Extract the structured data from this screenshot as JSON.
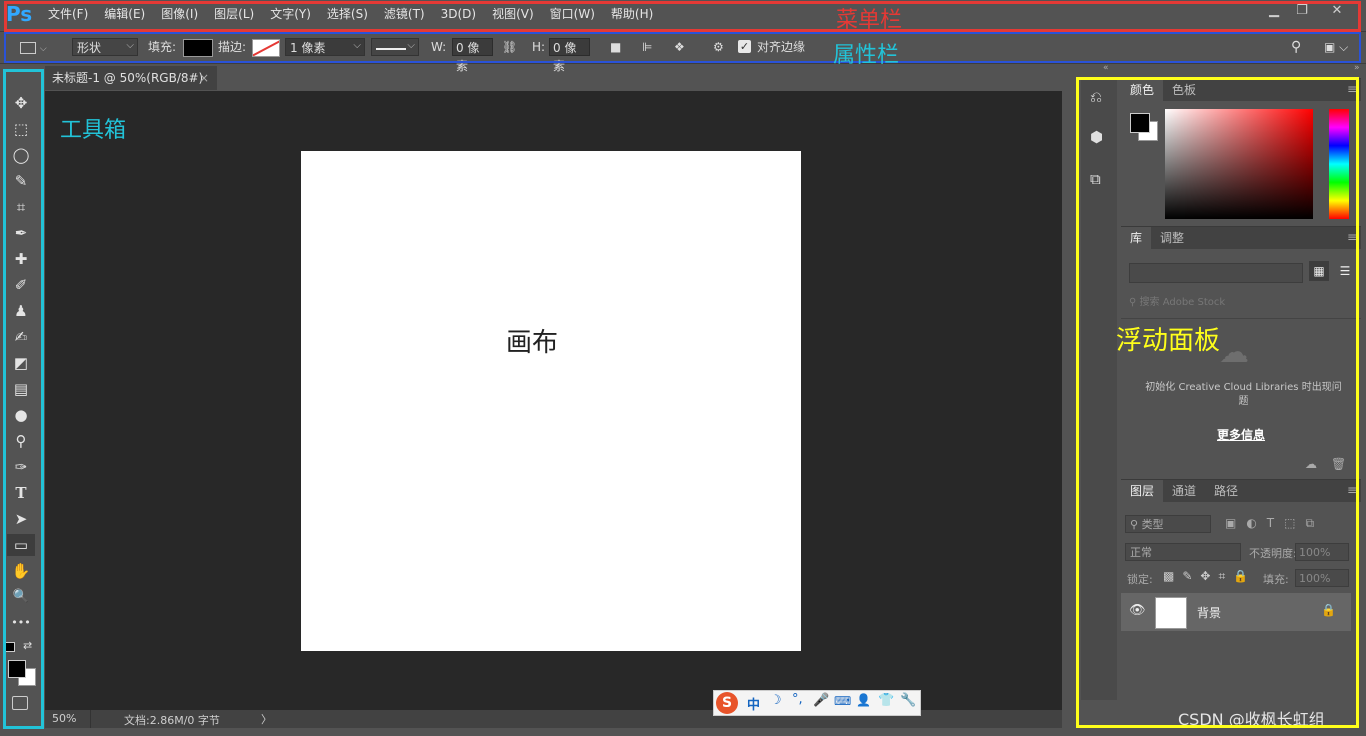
{
  "app": {
    "logo": "Ps"
  },
  "menu": [
    "文件(F)",
    "编辑(E)",
    "图像(I)",
    "图层(L)",
    "文字(Y)",
    "选择(S)",
    "滤镜(T)",
    "3D(D)",
    "视图(V)",
    "窗口(W)",
    "帮助(H)"
  ],
  "window_buttons": [
    "▁",
    "❐",
    "✕"
  ],
  "options": {
    "shape_mode": "形状",
    "fill_label": "填充:",
    "stroke_label": "描边:",
    "stroke_width": "1 像素",
    "w_label": "W:",
    "w_value": "0 像素",
    "h_label": "H:",
    "h_value": "0 像素",
    "align_edges": "对齐边缘"
  },
  "document": {
    "tab_title": "未标题-1 @ 50%(RGB/8#)",
    "tab_close": "×",
    "zoom": "50%",
    "doc_info": "文档:2.86M/0 字节",
    "arrow": "〉"
  },
  "tools": [
    {
      "name": "move-tool",
      "glyph": "✥"
    },
    {
      "name": "marquee-tool",
      "glyph": "⬚"
    },
    {
      "name": "lasso-tool",
      "glyph": "◯"
    },
    {
      "name": "quick-select-tool",
      "glyph": "✎"
    },
    {
      "name": "crop-tool",
      "glyph": "⌗"
    },
    {
      "name": "eyedropper-tool",
      "glyph": "✒"
    },
    {
      "name": "healing-tool",
      "glyph": "✚"
    },
    {
      "name": "brush-tool",
      "glyph": "✐"
    },
    {
      "name": "stamp-tool",
      "glyph": "♟"
    },
    {
      "name": "history-brush-tool",
      "glyph": "✍"
    },
    {
      "name": "eraser-tool",
      "glyph": "◩"
    },
    {
      "name": "gradient-tool",
      "glyph": "▤"
    },
    {
      "name": "blur-tool",
      "glyph": "●"
    },
    {
      "name": "dodge-tool",
      "glyph": "⚲"
    },
    {
      "name": "pen-tool",
      "glyph": "✑"
    },
    {
      "name": "type-tool",
      "glyph": "T"
    },
    {
      "name": "path-select-tool",
      "glyph": "➤"
    },
    {
      "name": "rectangle-tool",
      "glyph": "▭"
    },
    {
      "name": "hand-tool",
      "glyph": "✋"
    },
    {
      "name": "zoom-tool",
      "glyph": "🔍"
    },
    {
      "name": "more-tools",
      "glyph": "•••"
    }
  ],
  "panels": {
    "color": {
      "tabs": [
        "颜色",
        "色板"
      ]
    },
    "library": {
      "tabs": [
        "库",
        "调整"
      ],
      "search_placeholder": "搜索 Adobe Stock",
      "error_text": "初始化 Creative Cloud Libraries 时出现问题",
      "more_info": "更多信息"
    },
    "layers": {
      "tabs": [
        "图层",
        "通道",
        "路径"
      ],
      "filter_kind": "类型",
      "blend_mode": "正常",
      "opacity_label": "不透明度:",
      "opacity_value": "100%",
      "lock_label": "锁定:",
      "fill_label": "填充:",
      "fill_value": "100%",
      "layer_name": "背景"
    }
  },
  "annotations": {
    "menubar": "菜单栏",
    "optionsbar": "属性栏",
    "toolbox": "工具箱",
    "canvas": "画布",
    "panels": "浮动面板"
  },
  "colors": {
    "menubar_anno": "#e53935",
    "optionsbar_anno": "#2a52d8",
    "toolbox_anno": "#22c3d8",
    "panels_anno": "#ffff1a"
  },
  "watermark": "CSDN @收枫长虹组",
  "ime": {
    "label": "中"
  }
}
